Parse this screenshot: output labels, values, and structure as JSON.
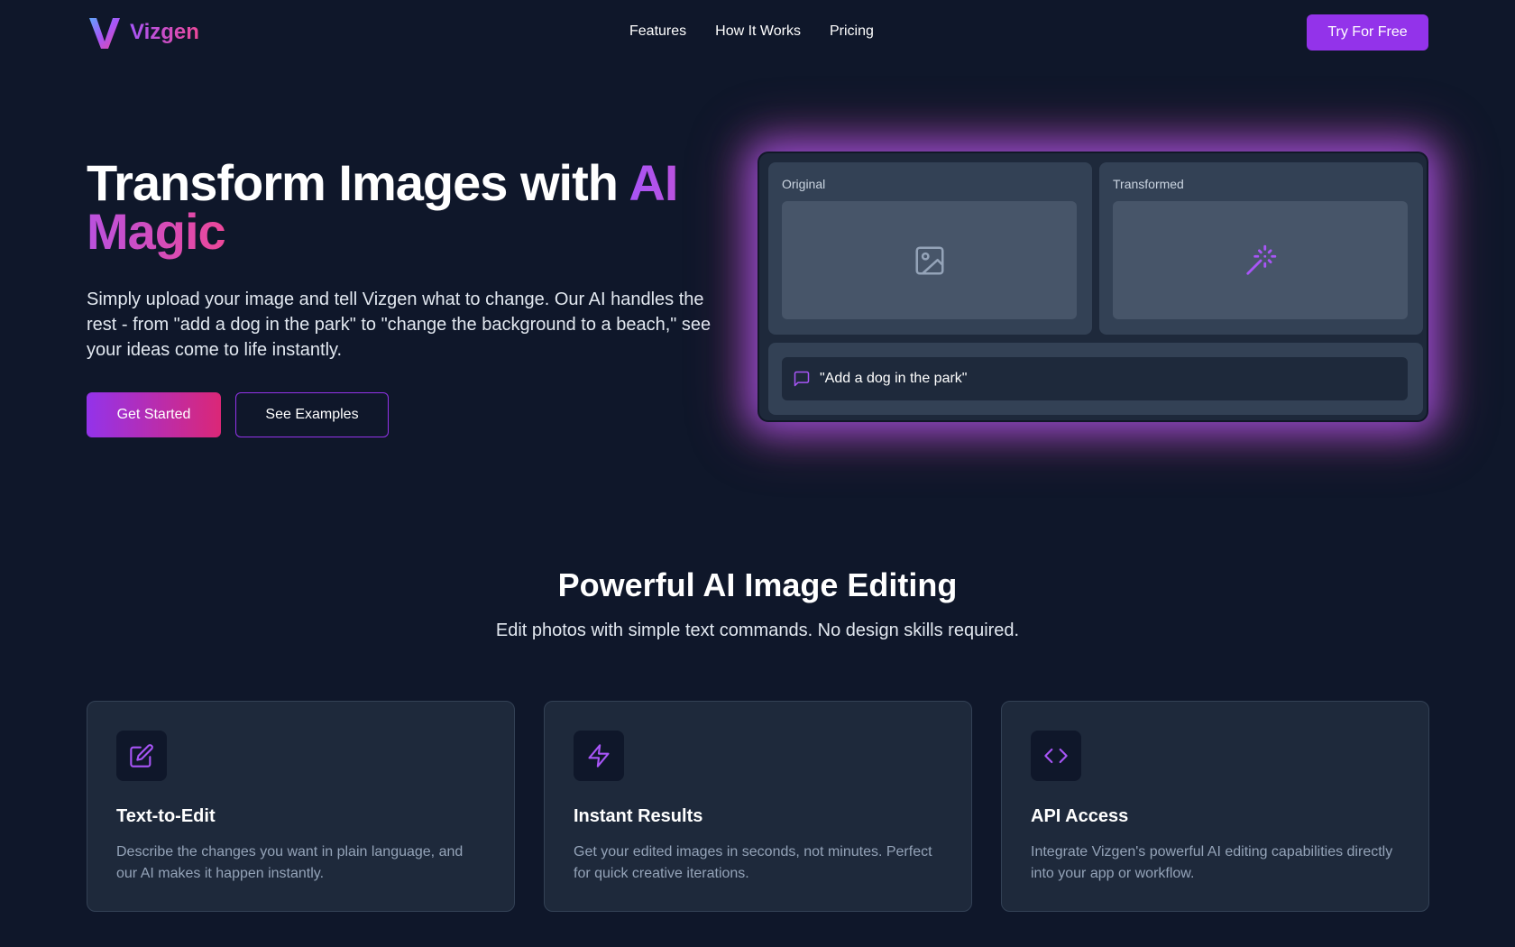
{
  "brand": {
    "name": "Vizgen",
    "logo_icon": "v-logo-icon",
    "gradient_start": "#a855f7",
    "gradient_end": "#ec4899"
  },
  "nav": {
    "items": [
      {
        "label": "Features"
      },
      {
        "label": "How It Works"
      },
      {
        "label": "Pricing"
      }
    ],
    "cta_label": "Try For Free"
  },
  "hero": {
    "title_main": "Transform Images with ",
    "title_accent": "AI Magic",
    "description": "Simply upload your image and tell Vizgen what to change. Our AI handles the rest - from \"add a dog in the park\" to \"change the background to a beach,\" see your ideas come to life instantly.",
    "primary_button": "Get Started",
    "secondary_button": "See Examples"
  },
  "demo": {
    "original_label": "Original",
    "original_icon": "image-icon",
    "transformed_label": "Transformed",
    "transformed_icon": "magic-wand-icon",
    "prompt_icon": "chat-bubble-icon",
    "prompt_text": "\"Add a dog in the park\""
  },
  "features": {
    "title": "Powerful AI Image Editing",
    "subtitle": "Edit photos with simple text commands. No design skills required.",
    "cards": [
      {
        "icon": "edit-icon",
        "title": "Text-to-Edit",
        "description": "Describe the changes you want in plain language, and our AI makes it happen instantly."
      },
      {
        "icon": "lightning-icon",
        "title": "Instant Results",
        "description": "Get your edited images in seconds, not minutes. Perfect for quick creative iterations."
      },
      {
        "icon": "code-icon",
        "title": "API Access",
        "description": "Integrate Vizgen's powerful AI editing capabilities directly into your app or workflow."
      }
    ]
  },
  "colors": {
    "background": "#0f172a",
    "card": "#1e293b",
    "accent": "#9333ea"
  }
}
